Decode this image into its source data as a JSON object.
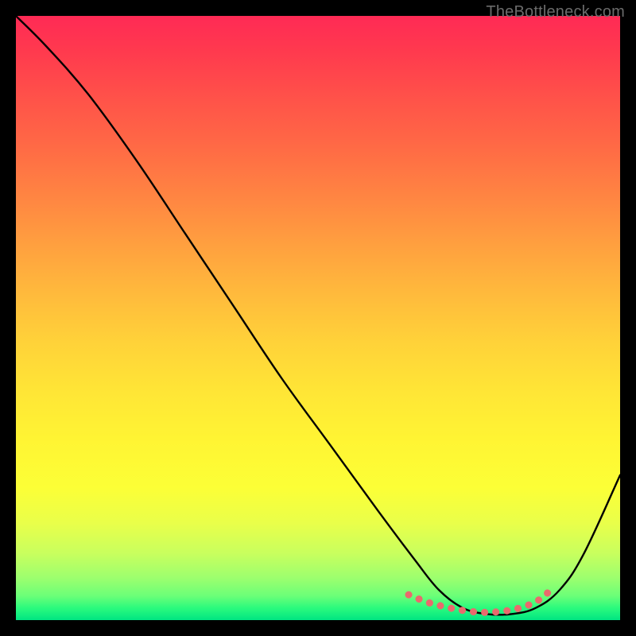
{
  "watermark": "TheBottleneck.com",
  "chart_data": {
    "type": "line",
    "title": "",
    "xlabel": "",
    "ylabel": "",
    "xlim": [
      0,
      100
    ],
    "ylim": [
      0,
      100
    ],
    "grid": false,
    "legend": false,
    "series": [
      {
        "name": "bottleneck-curve",
        "x": [
          0,
          5,
          12,
          20,
          28,
          36,
          44,
          52,
          60,
          66,
          70,
          74,
          78,
          82,
          86,
          90,
          94,
          100
        ],
        "y": [
          100,
          95,
          87,
          76,
          64,
          52,
          40,
          29,
          18,
          10,
          5,
          2,
          1,
          1,
          2,
          5,
          11,
          24
        ]
      }
    ],
    "highlight_segment": {
      "name": "optimal-range",
      "x": [
        65,
        68,
        71,
        74,
        77,
        80,
        83,
        86,
        88
      ],
      "y": [
        4.2,
        3.0,
        2.2,
        1.6,
        1.3,
        1.4,
        1.9,
        3.0,
        4.5
      ]
    },
    "colors": {
      "curve": "#000000",
      "highlight": "#ea6a6d",
      "gradient_top": "#ff2a55",
      "gradient_bottom": "#00e582",
      "page_bg": "#000000"
    }
  }
}
